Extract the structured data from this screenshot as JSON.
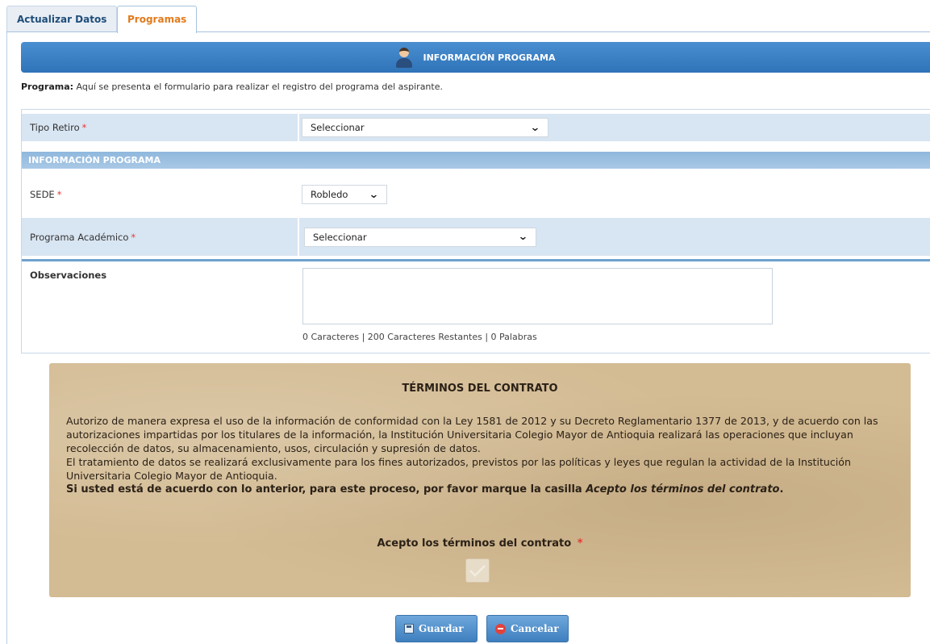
{
  "tabs": [
    {
      "label": "Actualizar Datos"
    },
    {
      "label": "Programas",
      "active": true
    }
  ],
  "header": {
    "title": "INFORMACIÓN PROGRAMA",
    "icon": "user-icon"
  },
  "description": {
    "label": "Programa:",
    "text": " Aquí se presenta el formulario para realizar el registro del programa del aspirante."
  },
  "form": {
    "tipo_retiro": {
      "label": "Tipo Retiro",
      "value": "Seleccionar"
    },
    "subheader": "INFORMACIÓN PROGRAMA",
    "sede": {
      "label": "SEDE",
      "value": "Robledo"
    },
    "programa": {
      "label": "Programa Académico",
      "value": "Seleccionar"
    },
    "observaciones": {
      "label": "Observaciones",
      "value": "",
      "counter": "0 Caracteres | 200 Caracteres Restantes | 0 Palabras"
    },
    "required_mark": "*"
  },
  "contract": {
    "title": "TÉRMINOS DEL CONTRATO",
    "paragraph1": "Autorizo de manera expresa el uso de la información de conformidad con la Ley 1581 de 2012 y su Decreto Reglamentario 1377 de 2013, y de acuerdo con las autorizaciones impartidas por los titulares de la información, la Institución Universitaria Colegio Mayor de Antioquia realizará las operaciones que incluyan recolección de datos, su almacenamiento, usos, circulación y supresión de datos.",
    "paragraph2": "El tratamiento de datos se realizará exclusivamente para los fines autorizados, previstos por las políticas y leyes que regulan la actividad de la Institución Universitaria Colegio Mayor de Antioquia.",
    "strong_prefix": "Si usted está de acuerdo con lo anterior, para este proceso, por favor marque la casilla ",
    "strong_italic": "Acepto los términos del contrato",
    "strong_suffix": ".",
    "accept_label": "Acepto los términos del contrato",
    "accept_checked": false
  },
  "buttons": {
    "save": "Guardar",
    "cancel": "Cancelar"
  },
  "colors": {
    "accent": "#e07b1d",
    "header_blue": "#2f73b8",
    "row_shade": "#d8e5f2",
    "required": "#e53935"
  }
}
